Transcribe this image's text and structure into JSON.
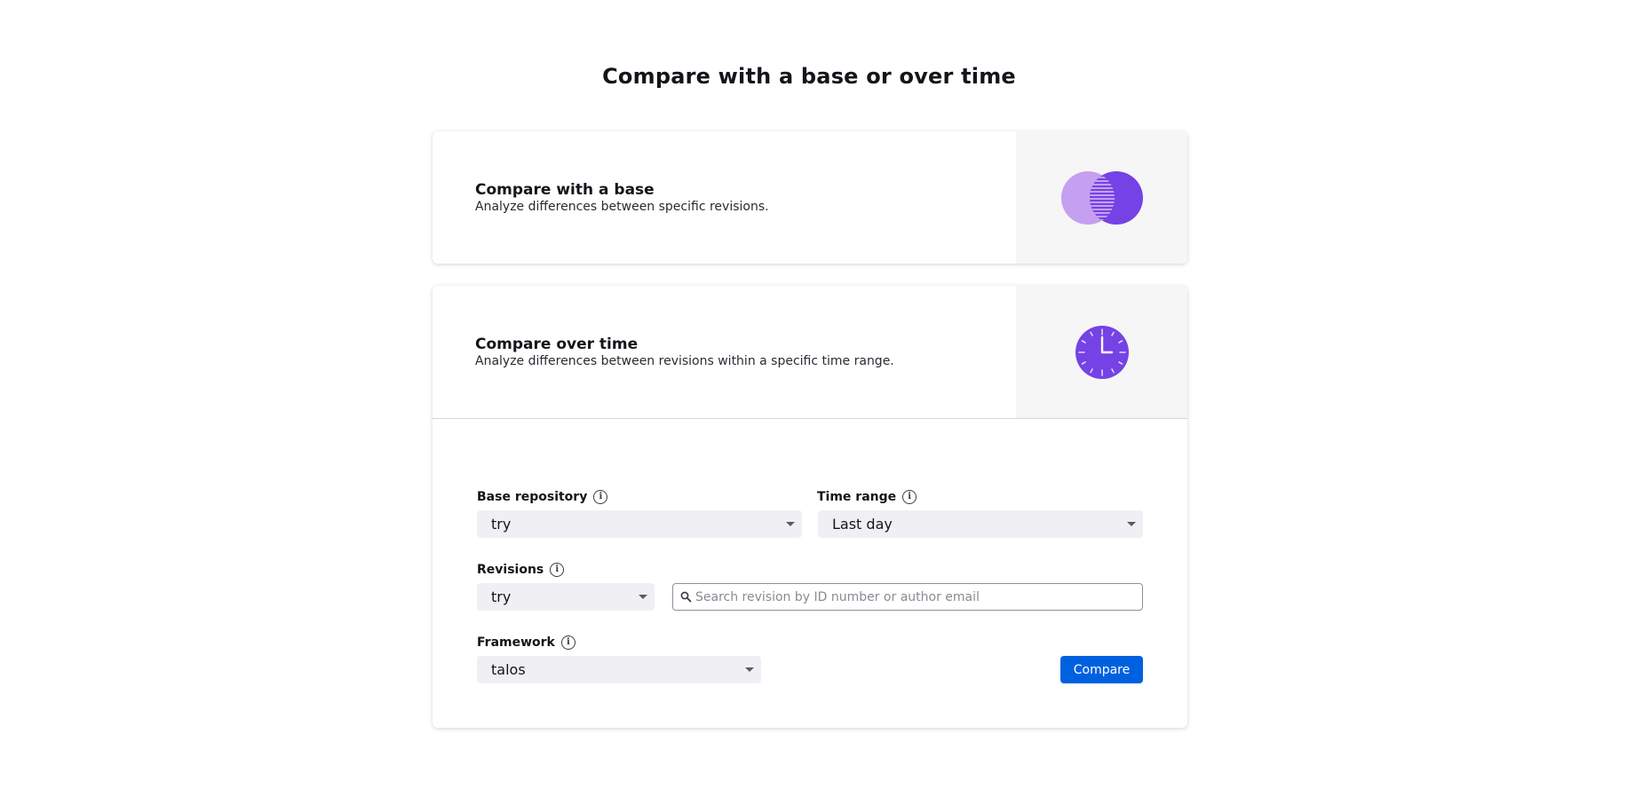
{
  "page": {
    "title": "Compare with a base or over time"
  },
  "base_card": {
    "title": "Compare with a base",
    "subtitle": "Analyze differences between specific revisions.",
    "illustration_icon": "overlapping-circles-icon"
  },
  "time_card": {
    "title": "Compare over time",
    "subtitle": "Analyze differences between revisions within a specific time range.",
    "illustration_icon": "clock-icon",
    "form": {
      "base_repository": {
        "label": "Base repository",
        "value": "try"
      },
      "time_range": {
        "label": "Time range",
        "value": "Last day"
      },
      "revisions": {
        "label": "Revisions",
        "repository_value": "try",
        "search_placeholder": "Search revision by ID number or author email"
      },
      "framework": {
        "label": "Framework",
        "value": "talos"
      },
      "compare_button": "Compare"
    }
  },
  "colors": {
    "accent": "#0061e0",
    "purple_dark": "#7542e5",
    "purple_light": "#c59ff0",
    "illustration_bg": "#f6f6f6",
    "select_bg": "#f0f0f4"
  }
}
